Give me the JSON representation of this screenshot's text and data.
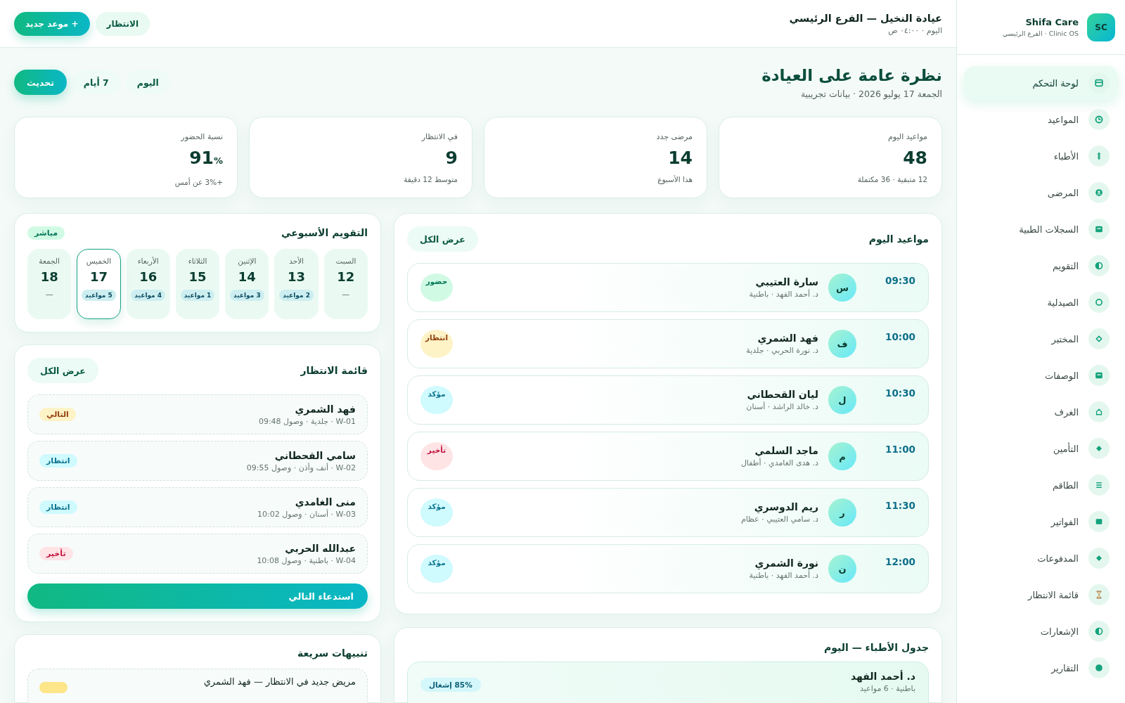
{
  "sidebar": {
    "brand": {
      "logo": "SC",
      "name": "Shifa Care",
      "subtitle": "Clinic OS · الفرع الرئيسي"
    },
    "items": [
      {
        "label": "لوحة التحكم",
        "selected": true
      },
      {
        "label": "المواعيد",
        "selected": false
      },
      {
        "label": "الأطباء",
        "selected": false
      },
      {
        "label": "المرضى",
        "selected": false
      },
      {
        "label": "السجلات الطبية",
        "selected": false
      },
      {
        "label": "التقويم",
        "selected": false
      },
      {
        "label": "الصيدلية",
        "selected": false
      },
      {
        "label": "المختبر",
        "selected": false
      },
      {
        "label": "الوصفات",
        "selected": false
      },
      {
        "label": "الغرف",
        "selected": false
      },
      {
        "label": "التأمين",
        "selected": false
      },
      {
        "label": "الطاقم",
        "selected": false
      },
      {
        "label": "الفواتير",
        "selected": false
      },
      {
        "label": "المدفوعات",
        "selected": false
      },
      {
        "label": "قائمة الانتظار",
        "selected": false
      },
      {
        "label": "الإشعارات",
        "selected": false
      },
      {
        "label": "التقارير",
        "selected": false
      }
    ]
  },
  "header": {
    "title": "عيادة النخيل — الفرع الرئيسي",
    "subtitle": "اليوم · ٠٤:٠٠ ص",
    "buttons": [
      {
        "label": "الانتظار",
        "kind": "secondary"
      },
      {
        "label": "+ موعد جديد",
        "kind": "primary"
      }
    ]
  },
  "overview": {
    "title": "نظرة عامة على العيادة",
    "subtitle": "الجمعة 17 يوليو 2026 · بيانات تجريبية",
    "buttons": [
      {
        "label": "اليوم",
        "kind": "secondary"
      },
      {
        "label": "7 أيام",
        "kind": "secondary"
      },
      {
        "label": "تحديث",
        "kind": "primary"
      }
    ]
  },
  "stats": [
    {
      "label": "مواعيد اليوم",
      "value": "48",
      "note": "12 متبقية · 36 مكتملة"
    },
    {
      "label": "مرضى جدد",
      "value": "14",
      "note": "هذا الأسبوع"
    },
    {
      "label": "في الانتظار",
      "value": "9",
      "note": "متوسط 12 دقيقة"
    },
    {
      "label": "نسبة الحضور",
      "value": "91",
      "unit": "%",
      "note": "+3% عن أمس"
    }
  ],
  "appointments": {
    "title": "مواعيد اليوم",
    "action": "عرض الكل",
    "rows": [
      {
        "time": "09:30",
        "initial": "س",
        "name": "سارة العتيبي",
        "details": "د. أحمد الفهد · باطنية",
        "status": "حضور",
        "kind": "present"
      },
      {
        "time": "10:00",
        "initial": "ف",
        "name": "فهد الشمري",
        "details": "د. نورة الحربي · جلدية",
        "status": "انتظار",
        "kind": "waiting"
      },
      {
        "time": "10:30",
        "initial": "ل",
        "name": "ليان القحطاني",
        "details": "د. خالد الراشد · أسنان",
        "status": "مؤكد",
        "kind": "confirmed"
      },
      {
        "time": "11:00",
        "initial": "م",
        "name": "ماجد السلمي",
        "details": "د. هدى الغامدي · أطفال",
        "status": "تأخير",
        "kind": "late"
      },
      {
        "time": "11:30",
        "initial": "ر",
        "name": "ريم الدوسري",
        "details": "د. سامي العتيبي · عظام",
        "status": "مؤكد",
        "kind": "confirmed"
      },
      {
        "time": "12:00",
        "initial": "ن",
        "name": "نورة الشمري",
        "details": "د. أحمد الفهد · باطنية",
        "status": "مؤكد",
        "kind": "confirmed"
      }
    ]
  },
  "doctors": {
    "title": "جدول الأطباء — اليوم",
    "rows": [
      {
        "name": "د. أحمد الفهد",
        "details": "باطنية · 6 مواعيد",
        "occupancy": "85% إشغال"
      }
    ]
  },
  "calendar": {
    "title": "التقويم الأسبوعي",
    "badge": "مباشر",
    "days": [
      {
        "weekday": "السبت",
        "date": "12",
        "count": "—",
        "kind": "empty",
        "selected": false
      },
      {
        "weekday": "الأحد",
        "date": "13",
        "count": "2 مواعيد",
        "kind": "busy",
        "selected": false
      },
      {
        "weekday": "الإثنين",
        "date": "14",
        "count": "3 مواعيد",
        "kind": "busy",
        "selected": false
      },
      {
        "weekday": "الثلاثاء",
        "date": "15",
        "count": "1 مواعيد",
        "kind": "busy",
        "selected": false
      },
      {
        "weekday": "الأربعاء",
        "date": "16",
        "count": "4 مواعيد",
        "kind": "busy",
        "selected": false
      },
      {
        "weekday": "الخميس",
        "date": "17",
        "count": "5 مواعيد",
        "kind": "busy",
        "selected": true
      },
      {
        "weekday": "الجمعة",
        "date": "18",
        "count": "—",
        "kind": "empty",
        "selected": false
      }
    ]
  },
  "waiting": {
    "title": "قائمة الانتظار",
    "action": "عرض الكل",
    "items": [
      {
        "name": "فهد الشمري",
        "details": "W-01 · جلدية · وصول 09:48",
        "status": "التالي",
        "kind": "next"
      },
      {
        "name": "سامي القحطاني",
        "details": "W-02 · أنف وأذن · وصول 09:55",
        "status": "انتظار",
        "kind": "waiting"
      },
      {
        "name": "منى الغامدي",
        "details": "W-03 · أسنان · وصول 10:02",
        "status": "انتظار",
        "kind": "waiting"
      },
      {
        "name": "عبدالله الحربي",
        "details": "W-04 · باطنية · وصول 10:08",
        "status": "تأخير",
        "kind": "late"
      }
    ],
    "call_button": "استدعاء التالي"
  },
  "alerts": {
    "title": "تنبيهات سريعة",
    "items": [
      {
        "text": "مريض جديد في الانتظار — فهد الشمري",
        "kind": "warning"
      }
    ]
  }
}
